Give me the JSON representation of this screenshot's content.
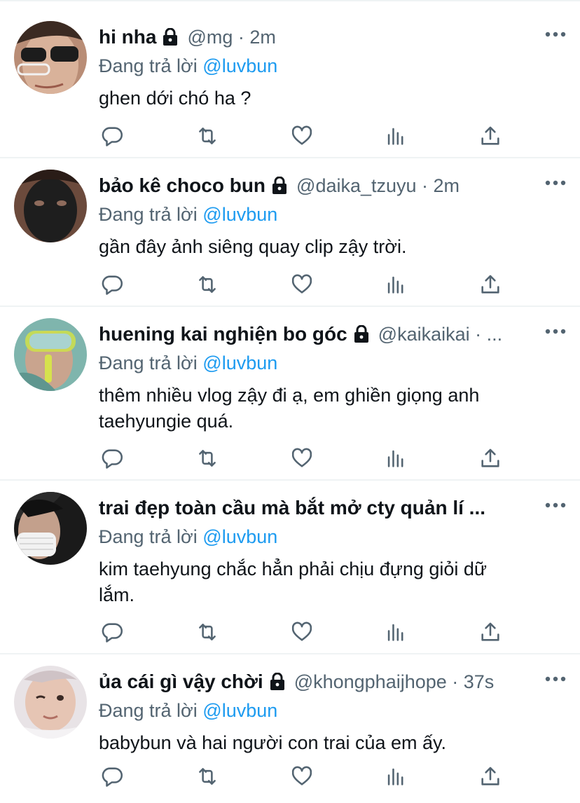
{
  "colors": {
    "link": "#1d9bf0",
    "muted": "#536471",
    "text": "#0f1419",
    "divider": "#eff3f4"
  },
  "icons": {
    "reply": "reply-icon",
    "retweet": "retweet-icon",
    "like": "heart-icon",
    "stats": "stats-icon",
    "share": "share-icon",
    "more": "more-icon",
    "lock": "lock-icon"
  },
  "tweets": [
    {
      "name": "hi nha",
      "meta": "@mg · 2m",
      "reply_prefix": "Đang trả lời",
      "reply_to": "@luvbun",
      "text": "ghen dới chó ha ?"
    },
    {
      "name": "bảo kê choco bun",
      "meta": "@daika_tzuyu · 2m",
      "reply_prefix": "Đang trả lời",
      "reply_to": "@luvbun",
      "text": "gần đây ảnh siêng quay clip zậy trời."
    },
    {
      "name": "huening kai nghiện bo góc",
      "meta": "@kaikaikai · ...",
      "reply_prefix": "Đang trả lời",
      "reply_to": "@luvbun",
      "text": "thêm nhiều vlog zậy đi ạ, em ghiền giọng anh\ntaehyungie quá."
    },
    {
      "name": "trai đẹp toàn cầu mà bắt mở cty quản lí ...",
      "meta": "",
      "reply_prefix": "Đang trả lời",
      "reply_to": "@luvbun",
      "text": "kim taehyung chắc hẳn phải chịu đựng giỏi dữ\nlắm."
    },
    {
      "name": "ủa cái gì vậy chời",
      "meta": "@khongphaijhope · 37s",
      "reply_prefix": "Đang trả lời",
      "reply_to": "@luvbun",
      "text": "babybun và hai người con trai của em ấy."
    }
  ]
}
